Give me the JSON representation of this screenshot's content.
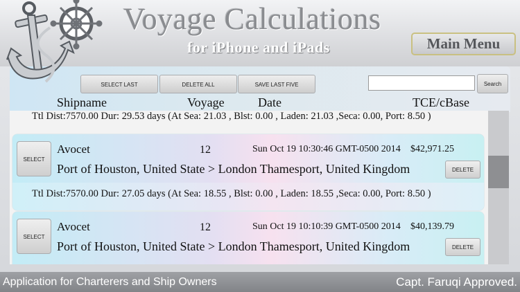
{
  "header": {
    "title": "Voyage Calculations",
    "subtitle": "for iPhone and iPads",
    "main_menu_label": "Main Menu",
    "logo_icon": "anchor-and-ship-wheel-icon"
  },
  "toolbar": {
    "select_last_label": "SELECT LAST",
    "delete_all_label": "DELETE ALL",
    "save_last_five_label": "SAVE LAST FIVE",
    "search_value": "",
    "search_label": "Search"
  },
  "columns": {
    "shipname": "Shipname",
    "voyage": "Voyage",
    "date": "Date",
    "tce": "TCE/cBase"
  },
  "list": {
    "top_summary": "Ttl Dist:7570.00  Dur: 29.53 days (At Sea: 21.03 , Blst: 0.00 , Laden: 21.03 ,Seca: 0.00, Port: 8.50 )",
    "records": [
      {
        "select_label": "SELECT",
        "shipname": "Avocet",
        "voyage": "12",
        "date": "Sun Oct 19 10:30:46 GMT-0500 2014",
        "tce": "$42,971.25",
        "route": "Port of Houston, United State >  London Thamesport, United Kingdom",
        "delete_label": "DELETE",
        "summary": "Ttl Dist:7570.00  Dur: 27.05 days (At Sea: 18.55 , Blst: 0.00 , Laden: 18.55 ,Seca: 0.00, Port: 8.50 )"
      },
      {
        "select_label": "SELECT",
        "shipname": "Avocet",
        "voyage": "12",
        "date": "Sun Oct 19 10:10:39 GMT-0500 2014",
        "tce": "$40,139.79",
        "route": "Port of Houston, United State >  London Thamesport, United Kingdom",
        "delete_label": "DELETE"
      }
    ]
  },
  "footer": {
    "left": "Application for Charterers and Ship Owners",
    "right": "Capt. Faruqi Approved."
  },
  "colors": {
    "title_gray": "#8a8c90",
    "menu_border": "#c9c081",
    "footer_bg": "#8f9195",
    "card_cyan": "#c3ecf6",
    "card_pink": "#f7e1ef"
  }
}
